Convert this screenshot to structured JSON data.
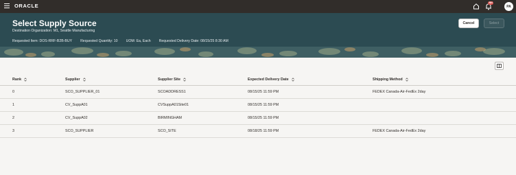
{
  "app": {
    "logo": "ORACLE",
    "notification_count": "NN",
    "user_initials": "PA"
  },
  "header": {
    "title": "Select Supply Source",
    "subtitle": "Destination Organization: M1, Seattle Manufacturing",
    "requested_item": "Requested Item: DOS-RRF-B2B-BUY",
    "requested_quantity": "Requested Quantity: 10",
    "uom": "UOM: Ea, Each",
    "requested_delivery_date": "Requested Delivery Date: 08/15/25 8:30 AM",
    "cancel_label": "Cancel",
    "select_label": "Select"
  },
  "table": {
    "columns": [
      "Rank",
      "Supplier",
      "Supplier Site",
      "Expected Delivery Date",
      "Shipping Method"
    ],
    "rows": [
      [
        "0",
        "SCO_SUPPLIER_01",
        "SCOADDRESS1",
        "08/15/25 11:59 PM",
        "FEDEX Canada-Air-FedEx 2day"
      ],
      [
        "1",
        "CV_SuppA01",
        "CVSuppA01Site01",
        "08/15/25 11:59 PM",
        ""
      ],
      [
        "2",
        "CV_SuppA02",
        "BIRMINGHAM",
        "08/15/25 11:59 PM",
        ""
      ],
      [
        "3",
        "SCO_SUPPLIER",
        "SCO_SITE",
        "08/18/25 11:59 PM",
        "FEDEX Canada-Air-FedEx 2day"
      ]
    ]
  },
  "icons": {
    "menu": "hamburger-icon",
    "home": "home-icon",
    "notifications": "bell-icon",
    "sort": "sort-icon",
    "columns": "columns-icon"
  },
  "colors": {
    "topbar": "#312d2a",
    "header": "#2c4b52",
    "badge": "#d9534f",
    "page_background": "#f6f5f3"
  }
}
